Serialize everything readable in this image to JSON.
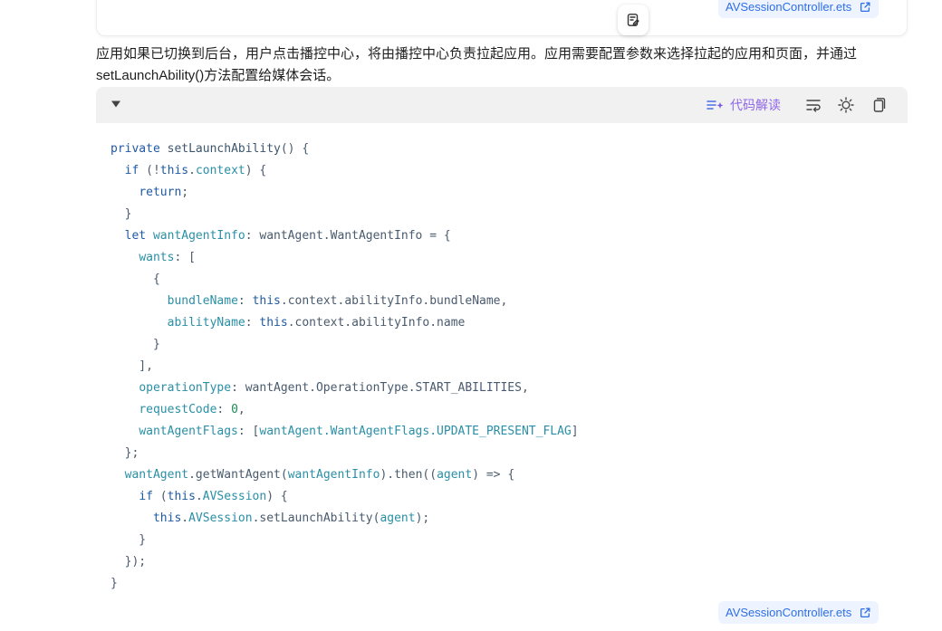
{
  "top_file_chip": {
    "label": "AVSessionController.ets"
  },
  "bottom_file_chip": {
    "label": "AVSessionController.ets"
  },
  "paragraph": {
    "line1": "应用如果已切换到后台，用户点击播控中心，将由播控中心负责拉起应用。应用需要配置参数来选择拉起的应用和页面，并通过",
    "line2": "setLaunchAbility()方法配置给媒体会话。"
  },
  "code_toolbar": {
    "ai_label": "代码解读"
  },
  "icons": [
    "edit-icon",
    "external-link-icon",
    "collapse-triangle-icon",
    "ai-sparkle-icon",
    "wrap-icon",
    "theme-icon",
    "copy-icon"
  ],
  "colors": {
    "accent": "#2f6fe4",
    "ai": "#8f67e8",
    "keyword": "#1f5aa5",
    "property": "#2a8fa6",
    "number": "#1f8a57"
  },
  "code": [
    [
      [
        "kw",
        "private "
      ],
      [
        "fn",
        "setLaunchAbility"
      ],
      [
        "pl",
        "() {"
      ]
    ],
    [
      [
        "pl",
        "  "
      ],
      [
        "kw",
        "if "
      ],
      [
        "pl",
        "(!"
      ],
      [
        "kw",
        "this"
      ],
      [
        "pl",
        "."
      ],
      [
        "pr",
        "context"
      ],
      [
        "pl",
        ") {"
      ]
    ],
    [
      [
        "pl",
        "    "
      ],
      [
        "kw",
        "return"
      ],
      [
        "pl",
        ";"
      ]
    ],
    [
      [
        "pl",
        "  }"
      ]
    ],
    [
      [
        "pl",
        "  "
      ],
      [
        "kw",
        "let "
      ],
      [
        "pr",
        "wantAgentInfo"
      ],
      [
        "pl",
        ": wantAgent.WantAgentInfo = {"
      ]
    ],
    [
      [
        "pl",
        "    "
      ],
      [
        "pr",
        "wants"
      ],
      [
        "pl",
        ": ["
      ]
    ],
    [
      [
        "pl",
        "      {"
      ]
    ],
    [
      [
        "pl",
        "        "
      ],
      [
        "pr",
        "bundleName"
      ],
      [
        "pl",
        ": "
      ],
      [
        "kw",
        "this"
      ],
      [
        "pl",
        ".context.abilityInfo.bundleName,"
      ]
    ],
    [
      [
        "pl",
        "        "
      ],
      [
        "pr",
        "abilityName"
      ],
      [
        "pl",
        ": "
      ],
      [
        "kw",
        "this"
      ],
      [
        "pl",
        ".context.abilityInfo.name"
      ]
    ],
    [
      [
        "pl",
        "      }"
      ]
    ],
    [
      [
        "pl",
        "    ],"
      ]
    ],
    [
      [
        "pl",
        "    "
      ],
      [
        "pr",
        "operationType"
      ],
      [
        "pl",
        ": wantAgent.OperationType.START_ABILITIES,"
      ]
    ],
    [
      [
        "pl",
        "    "
      ],
      [
        "pr",
        "requestCode"
      ],
      [
        "pl",
        ": "
      ],
      [
        "num",
        "0"
      ],
      [
        "pl",
        ","
      ]
    ],
    [
      [
        "pl",
        "    "
      ],
      [
        "pr",
        "wantAgentFlags"
      ],
      [
        "pl",
        ": ["
      ],
      [
        "pr",
        "wantAgent.WantAgentFlags.UPDATE_PRESENT_FLAG"
      ],
      [
        "pl",
        "]"
      ]
    ],
    [
      [
        "pl",
        "  };"
      ]
    ],
    [
      [
        "pl",
        "  "
      ],
      [
        "pr",
        "wantAgent"
      ],
      [
        "pl",
        ".getWantAgent("
      ],
      [
        "pr",
        "wantAgentInfo"
      ],
      [
        "pl",
        ").then(("
      ],
      [
        "pr",
        "agent"
      ],
      [
        "pl",
        ") => {"
      ]
    ],
    [
      [
        "pl",
        "    "
      ],
      [
        "kw",
        "if "
      ],
      [
        "pl",
        "("
      ],
      [
        "kw",
        "this"
      ],
      [
        "pl",
        "."
      ],
      [
        "pr",
        "AVSession"
      ],
      [
        "pl",
        ") {"
      ]
    ],
    [
      [
        "pl",
        "      "
      ],
      [
        "kw",
        "this"
      ],
      [
        "pl",
        "."
      ],
      [
        "pr",
        "AVSession"
      ],
      [
        "pl",
        ".setLaunchAbility("
      ],
      [
        "pr",
        "agent"
      ],
      [
        "pl",
        ");"
      ]
    ],
    [
      [
        "pl",
        "    }"
      ]
    ],
    [
      [
        "pl",
        "  });"
      ]
    ],
    [
      [
        "pl",
        "}"
      ]
    ]
  ]
}
